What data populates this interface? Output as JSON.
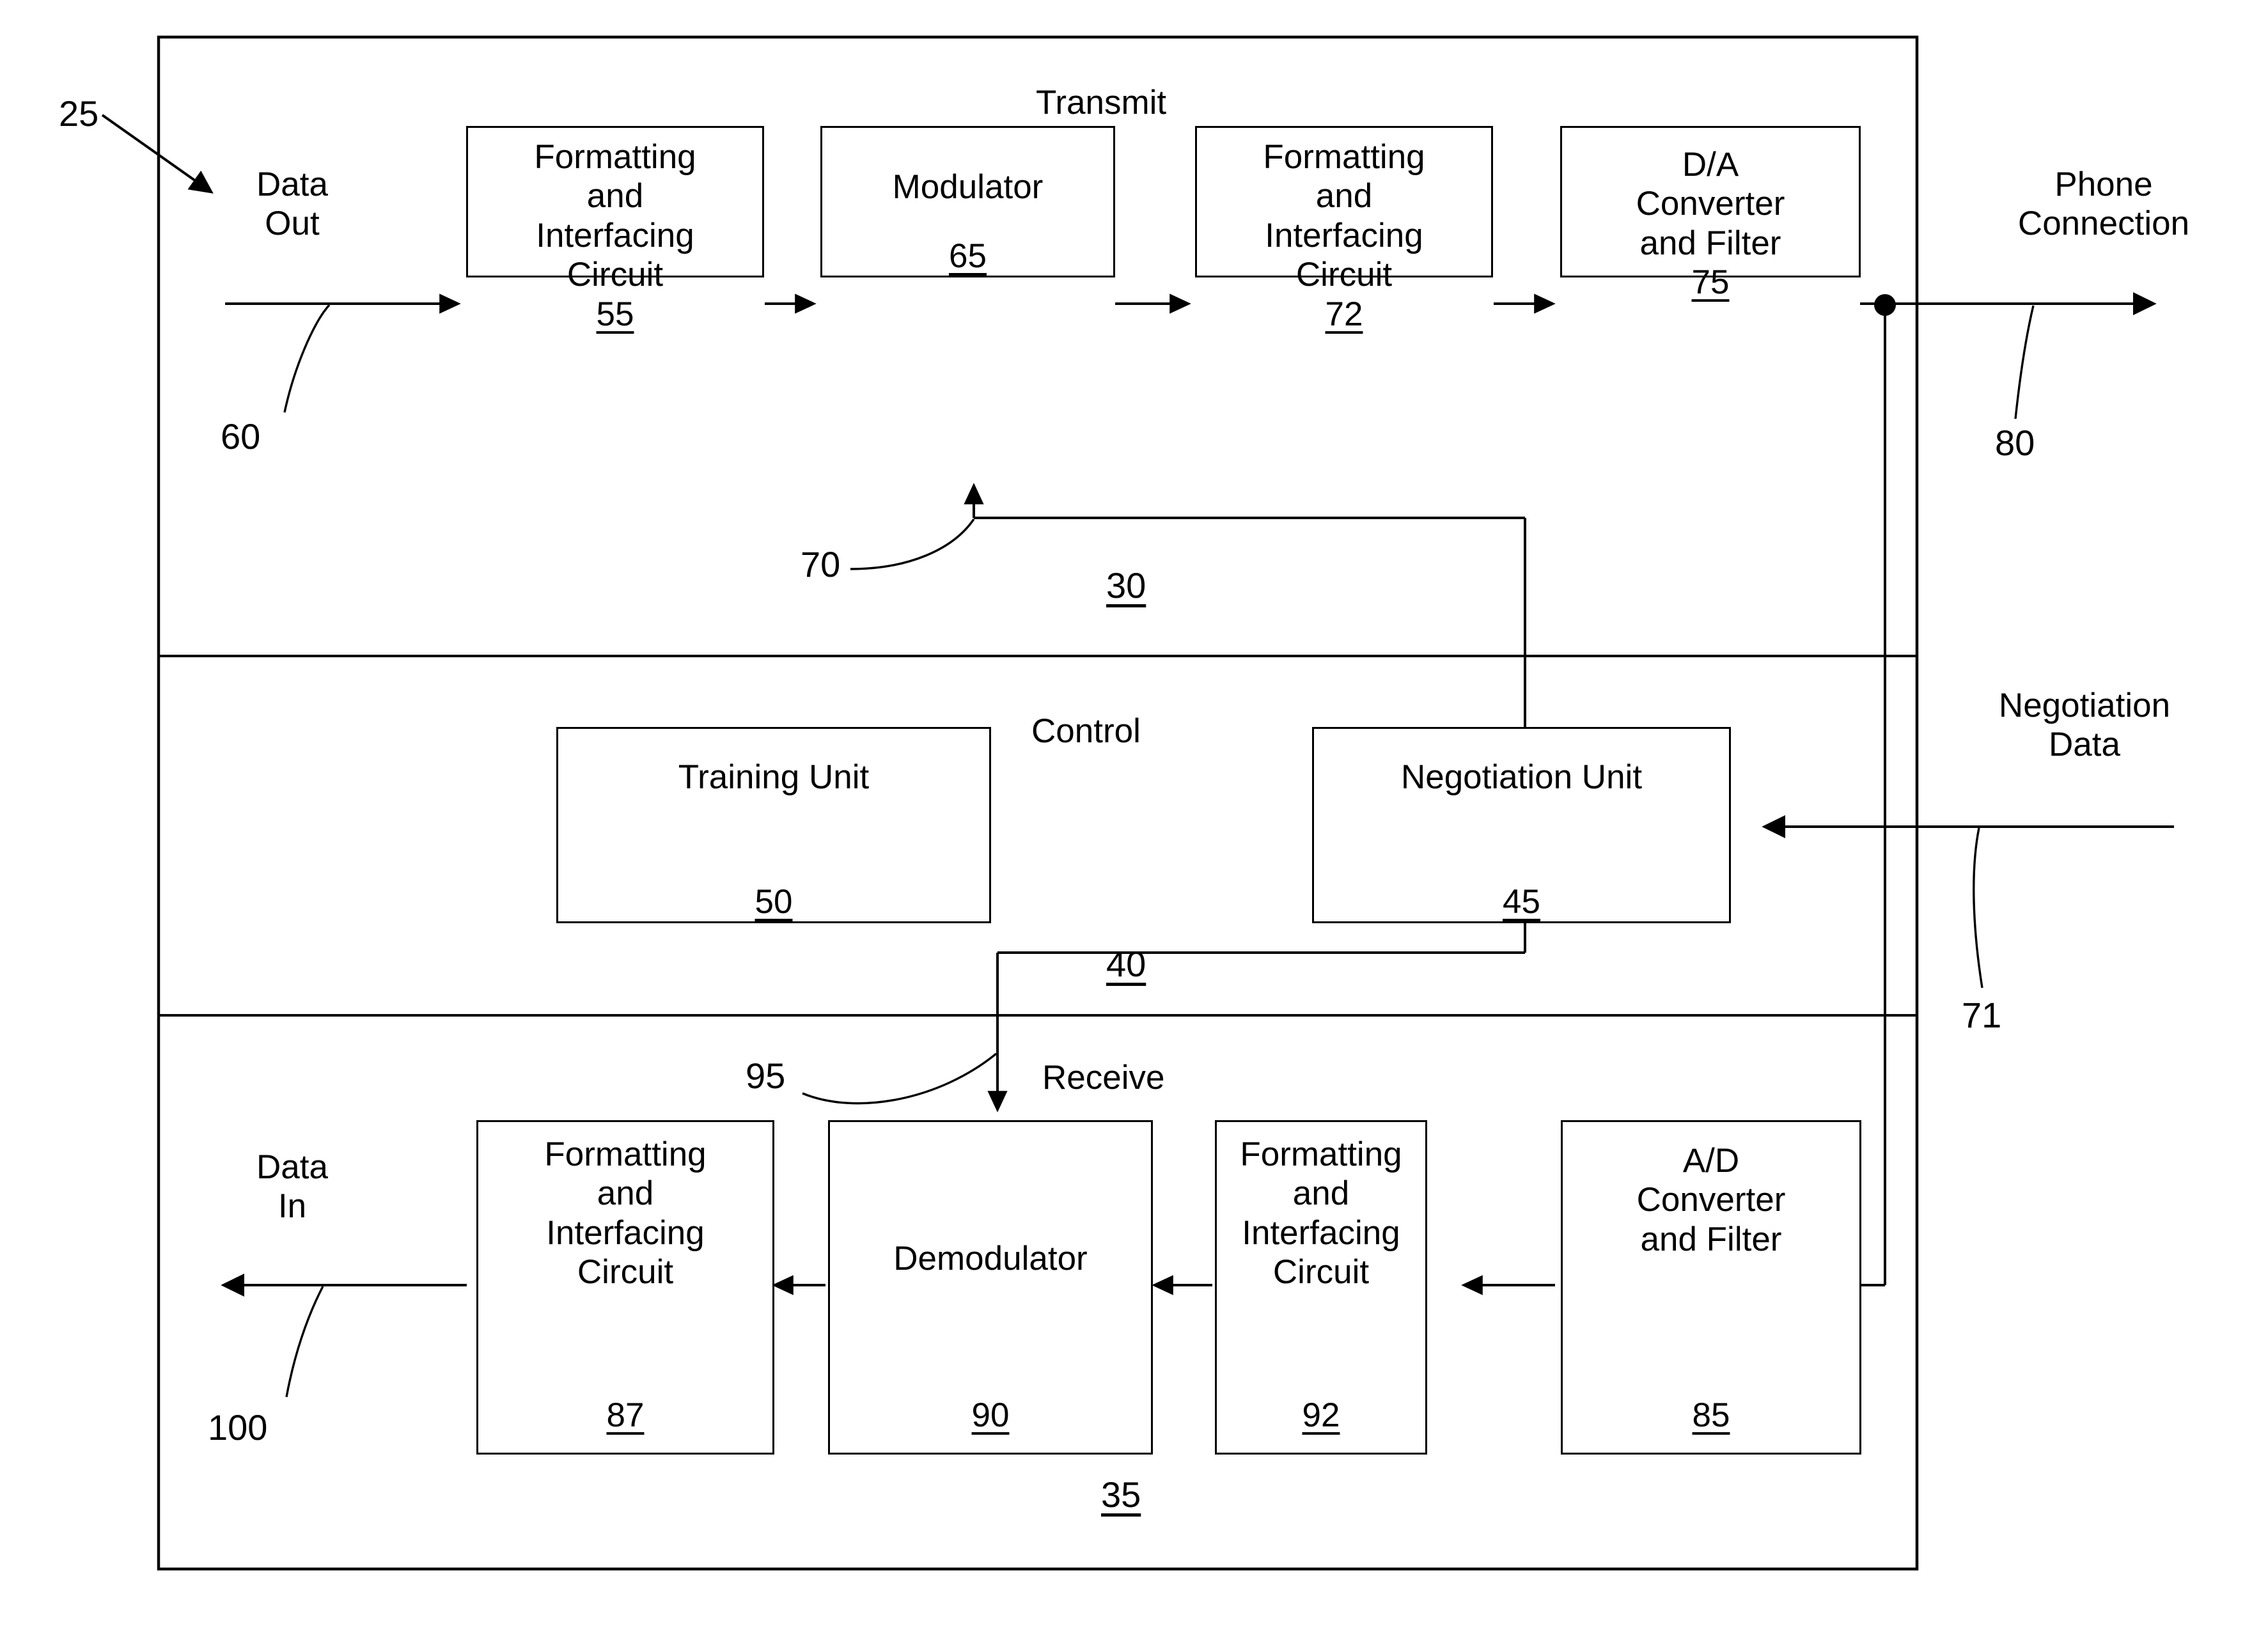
{
  "figure": {
    "outer_ref": "25",
    "sections": {
      "transmit": {
        "label": "Transmit",
        "ref": "30",
        "io_left_label": "Data\nOut",
        "io_left_line1": "Data",
        "io_left_line2": "Out",
        "io_left_ref": "60",
        "io_right_line1": "Phone",
        "io_right_line2": "Connection",
        "io_right_ref": "80",
        "control_line_ref": "70",
        "blocks": [
          {
            "lines": [
              "Formatting",
              "and",
              "Interfacing",
              "Circuit"
            ],
            "num": "55"
          },
          {
            "lines": [
              "Modulator"
            ],
            "num": "65"
          },
          {
            "lines": [
              "Formatting",
              "and",
              "Interfacing",
              "Circuit"
            ],
            "num": "72"
          },
          {
            "lines": [
              "D/A",
              "Converter",
              "and Filter"
            ],
            "num": "75"
          }
        ]
      },
      "control": {
        "label": "Control",
        "ref": "40",
        "io_right_line1": "Negotiation",
        "io_right_line2": "Data",
        "io_right_ref": "71",
        "blocks": [
          {
            "lines": [
              "Training Unit"
            ],
            "num": "50"
          },
          {
            "lines": [
              "Negotiation Unit"
            ],
            "num": "45"
          }
        ]
      },
      "receive": {
        "label": "Receive",
        "ref": "35",
        "io_left_line1": "Data",
        "io_left_line2": "In",
        "io_left_ref": "100",
        "control_line_ref": "95",
        "blocks": [
          {
            "lines": [
              "Formatting",
              "and",
              "Interfacing",
              "Circuit"
            ],
            "num": "87"
          },
          {
            "lines": [
              "Demodulator"
            ],
            "num": "90"
          },
          {
            "lines": [
              "Formatting",
              "and",
              "Interfacing",
              "Circuit"
            ],
            "num": "92"
          },
          {
            "lines": [
              "A/D",
              "Converter",
              "and Filter"
            ],
            "num": "85"
          }
        ]
      }
    },
    "colors": {
      "ink": "#000000",
      "paper": "#ffffff"
    }
  }
}
